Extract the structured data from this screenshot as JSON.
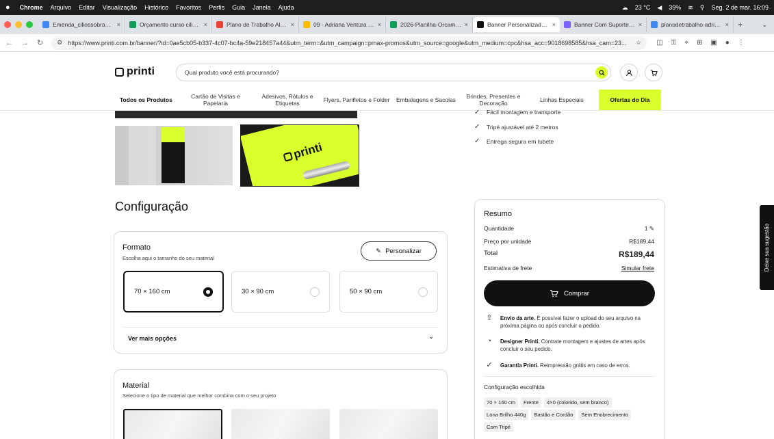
{
  "menubar": {
    "app": "Chrome",
    "items": [
      "Arquivo",
      "Editar",
      "Visualização",
      "Histórico",
      "Favoritos",
      "Perfis",
      "Guia",
      "Janela",
      "Ajuda"
    ],
    "weather": "23 °C",
    "battery": "39%",
    "datetime": "Seg. 2 de mar. 16:09"
  },
  "tabs": [
    {
      "label": "Emenda_ciliossobrancelh",
      "color": "#4285f4"
    },
    {
      "label": "Orçamento curso cilios/s",
      "color": "#0f9d58"
    },
    {
      "label": "Plano de Trabalho Aldeia",
      "color": "#ea4335"
    },
    {
      "label": "09 - Adriana Ventura - Sã",
      "color": "#fbbc04"
    },
    {
      "label": "2026-Planilha-Orcament",
      "color": "#0f9d58"
    },
    {
      "label": "Banner Personalizado | D",
      "color": "#111111",
      "active": true
    },
    {
      "label": "Banner Com Suporte X |",
      "color": "#7b61ff"
    },
    {
      "label": "planodetrabalho-adriana",
      "color": "#4285f4"
    }
  ],
  "address": {
    "url": "https://www.printi.com.br/banner/?id=0ae5cb05-b337-4c07-bc4a-59e218457a44&utm_term=&utm_campaign=pmax-promos&utm_source=google&utm_medium=cpc&hsa_acc=9018698585&hsa_cam=23..."
  },
  "header": {
    "logo": "printi",
    "search_placeholder": "Qual produto você está procurando?"
  },
  "categories": [
    {
      "label": "Todos os Produtos",
      "bold": true
    },
    {
      "label": "Cartão de Visitas e Papelaria"
    },
    {
      "label": "Adesivos, Rótulos e Etiquetas"
    },
    {
      "label": "Flyers, Panfletos e Folder"
    },
    {
      "label": "Embalagens e Sacolas"
    },
    {
      "label": "Brindes, Presentes e Decoração"
    },
    {
      "label": "Linhas Especiais"
    },
    {
      "label": "Ofertas do Dia",
      "offer": true
    }
  ],
  "features": [
    "Fácil montagem e transporte",
    "Tripé ajustável até 2 metros",
    "Entrega segura em tubete"
  ],
  "thumb_text": "printi",
  "config": {
    "title": "Configuração",
    "format": {
      "title": "Formato",
      "subtitle": "Escolha aqui o tamanho do seu material",
      "personalize": "Personalizar",
      "options": [
        {
          "label": "70 × 160 cm",
          "selected": true
        },
        {
          "label": "30 × 90 cm",
          "selected": false
        },
        {
          "label": "50 × 90 cm",
          "selected": false
        }
      ],
      "more": "Ver mais opções"
    },
    "material": {
      "title": "Material",
      "subtitle": "Selecione o tipo de material que melhor combina com o seu projeto"
    }
  },
  "summary": {
    "title": "Resumo",
    "qty_label": "Quantidade",
    "qty": "1",
    "unit_label": "Preço por unidade",
    "unit_price": "R$189,44",
    "total_label": "Total",
    "total": "R$189,44",
    "shipping_label": "Estimativa de frete",
    "shipping_link": "Simular frete",
    "buy": "Comprar",
    "info": [
      {
        "title": "Envio da arte.",
        "text": "É possível fazer o upload do seu arquivo na próxima página ou após concluir o pedido.",
        "icon": "upload-icon"
      },
      {
        "title": "Designer Printi.",
        "text": "Contrate montagem e ajustes de artes após concluir o seu pedido.",
        "icon": "palette-icon"
      },
      {
        "title": "Garantia Printi.",
        "text": "Reimpressão grátis em caso de erros.",
        "icon": "check-circle-icon"
      }
    ],
    "chosen_title": "Configuração escolhida",
    "chips": [
      "70 × 160 cm",
      "Frente",
      "4×0 (colorido, sem branco)",
      "Lona Brilho 440g",
      "Bastão e Cordão",
      "Sem Enobrecimento",
      "Com Tripé"
    ]
  },
  "feedback": "Deixe sua sugestão",
  "colors": {
    "accent": "#d9ff2c",
    "dark": "#111111"
  }
}
